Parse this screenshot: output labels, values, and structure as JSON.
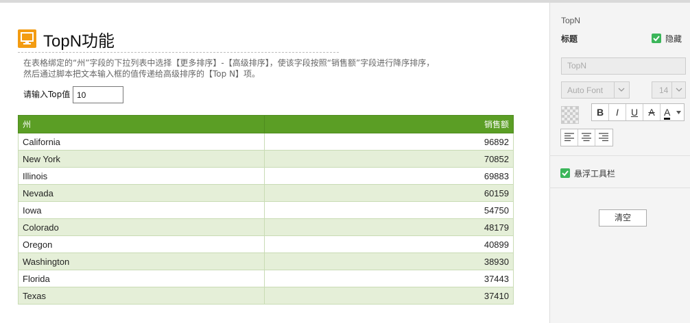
{
  "header": {
    "title": "TopN功能",
    "icon": "monitor-icon",
    "accent": "#f39c12"
  },
  "description": "在表格绑定的“州”字段的下拉列表中选择【更多排序】-【高级排序】，使该字段按照“销售额”字段进行降序排序，然后通过脚本把文本输入框的值传递给高级排序的【Top N】项。",
  "topn": {
    "label": "请输入Top值",
    "value": "10"
  },
  "table": {
    "columns": [
      "州",
      "销售额"
    ],
    "header_color": "#5b9e25",
    "rows": [
      [
        "California",
        "96892"
      ],
      [
        "New York",
        "70852"
      ],
      [
        "Illinois",
        "69883"
      ],
      [
        "Nevada",
        "60159"
      ],
      [
        "Iowa",
        "54750"
      ],
      [
        "Colorado",
        "48179"
      ],
      [
        "Oregon",
        "40899"
      ],
      [
        "Washington",
        "38930"
      ],
      [
        "Florida",
        "37443"
      ],
      [
        "Texas",
        "37410"
      ]
    ]
  },
  "panel": {
    "section_title": "TopN",
    "title_label": "标题",
    "hide_label": "隐藏",
    "hide_checked": true,
    "title_text": "TopN",
    "font_family": "Auto Font",
    "font_size": "14",
    "bold": "B",
    "italic": "I",
    "underline": "U",
    "strike": "A",
    "font_color": "A",
    "float_toolbar_label": "悬浮工具栏",
    "float_toolbar_checked": true,
    "clear_label": "清空"
  }
}
